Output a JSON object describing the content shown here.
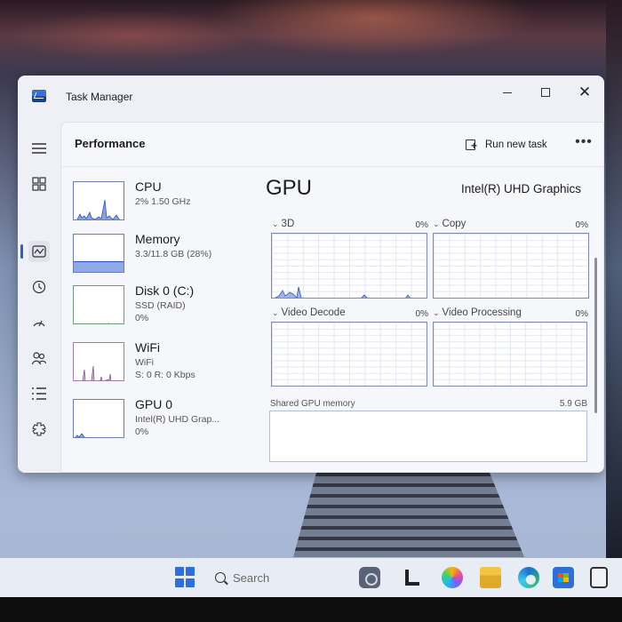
{
  "window": {
    "title": "Task Manager"
  },
  "page": {
    "title": "Performance",
    "run_new_task": "Run new task",
    "more": "•••"
  },
  "devices": [
    {
      "name": "CPU",
      "line1": "2%  1.50 GHz",
      "line2": ""
    },
    {
      "name": "Memory",
      "line1": "3.3/11.8 GB (28%)",
      "line2": ""
    },
    {
      "name": "Disk 0 (C:)",
      "line1": "SSD (RAID)",
      "line2": "0%"
    },
    {
      "name": "WiFi",
      "line1": "WiFi",
      "line2": "S: 0  R: 0 Kbps"
    },
    {
      "name": "GPU 0",
      "line1": "Intel(R) UHD Grap...",
      "line2": "0%"
    }
  ],
  "gpu": {
    "title": "GPU",
    "model": "Intel(R) UHD Graphics",
    "engines": [
      {
        "name": "3D",
        "percent": "0%"
      },
      {
        "name": "Copy",
        "percent": "0%"
      },
      {
        "name": "Video Decode",
        "percent": "0%"
      },
      {
        "name": "Video Processing",
        "percent": "0%"
      }
    ],
    "shared_memory_label": "Shared GPU memory",
    "shared_memory_value": "5.9 GB"
  },
  "taskbar": {
    "search_placeholder": "Search"
  },
  "colors": {
    "accent": "#2d5ed6",
    "graph_border": "#7c8ab8",
    "memory_fill": "#6f8fd6"
  },
  "icons": {
    "nav": [
      "hamburger-icon",
      "processes-icon",
      "performance-icon",
      "app-history-icon",
      "startup-apps-icon",
      "users-icon",
      "details-icon",
      "services-icon",
      "settings-icon"
    ]
  }
}
